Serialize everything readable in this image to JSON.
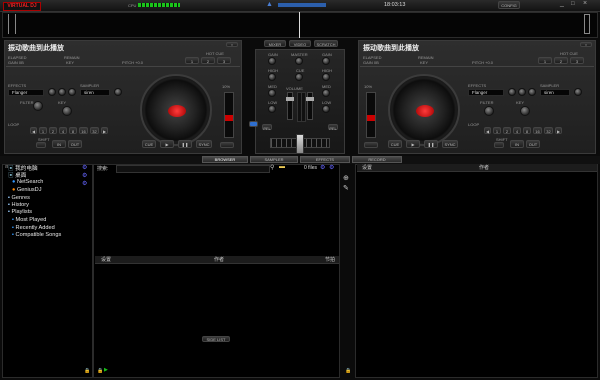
{
  "titlebar": {
    "logo": "VIRTUAL DJ",
    "cpu_label": "CPU",
    "time": "18:03:13",
    "config_label": "CONFIG"
  },
  "center_tabs": [
    "MIXER",
    "VIDEO",
    "SCRATCH"
  ],
  "deck_left": {
    "title": "振动歌曲到此播放",
    "elapsed_label": "ELAPSED",
    "remain_label": "REMAIN",
    "gain_label": "GAIN 0B",
    "key_label": "KEY",
    "pitch_label": "PITCH +0.0",
    "hot_cue_label": "HOT CUE",
    "hot_cues": [
      "1",
      "2",
      "3"
    ],
    "effects_label": "EFFECTS",
    "effect_value": "Flanger",
    "sampler_label": "SAMPLER",
    "sampler_value": "siren",
    "filter_label": "FILTER",
    "key_knob_label": "KEY",
    "loop_label": "LOOP",
    "loop_values": [
      "1",
      "2",
      "4",
      "8",
      "16",
      "32"
    ],
    "shift_label": "SHIFT",
    "in_label": "IN",
    "out_label": "OUT",
    "cue_label": "CUE",
    "sync_label": "SYNC",
    "pct_label": "10%"
  },
  "deck_right": {
    "title": "振动歌曲到此播放",
    "elapsed_label": "ELAPSED",
    "remain_label": "REMAIN",
    "gain_label": "GAIN 0B",
    "key_label": "KEY",
    "pitch_label": "PITCH +0.0",
    "hot_cue_label": "HOT CUE",
    "hot_cues": [
      "1",
      "2",
      "3"
    ],
    "effects_label": "EFFECTS",
    "effect_value": "Flanger",
    "sampler_label": "SAMPLER",
    "sampler_value": "siren",
    "filter_label": "FILTER",
    "key_knob_label": "KEY",
    "loop_label": "LOOP",
    "loop_values": [
      "1",
      "2",
      "4",
      "8",
      "16",
      "32"
    ],
    "shift_label": "SHIFT",
    "in_label": "IN",
    "out_label": "OUT",
    "cue_label": "CUE",
    "sync_label": "SYNC",
    "pct_label": "10%"
  },
  "mixer": {
    "knob_labels": [
      "GAIN",
      "MASTER",
      "GAIN",
      "HIGH",
      "CUE",
      "HIGH",
      "MED",
      "MED",
      "LOW",
      "VOLUME",
      "LOW"
    ],
    "volume_label": "VOLUME",
    "pfl": "PFL"
  },
  "bottom_tabs": [
    "BROWSER",
    "SAMPLER",
    "EFFECTS",
    "RECORD"
  ],
  "browser": {
    "tree": [
      "我的电脑",
      "桌面",
      "NetSearch",
      "GeniusDJ",
      "Genres",
      "History",
      "Playlists",
      "Most Played",
      "Recently Added",
      "Compatible Songs"
    ],
    "search_label": "搜索:",
    "files_count": "0 files",
    "columns": [
      "设置",
      "作者",
      "节拍"
    ],
    "side_list_label": "SIDE LIST",
    "sidelist_columns": [
      "设置",
      "作者"
    ]
  },
  "colors": {
    "accent_red": "#e01010",
    "accent_blue": "#2f6fcf",
    "vu_green": "#19c419"
  }
}
